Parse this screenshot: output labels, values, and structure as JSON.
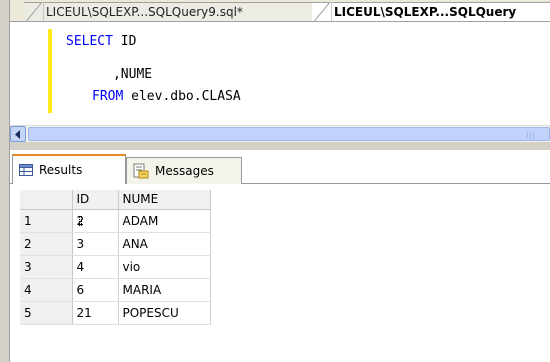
{
  "tabs": {
    "inactive_label": "LICEUL\\SQLEXP...SQLQuery9.sql*",
    "active_label": "LICEUL\\SQLEXP...SQLQuery"
  },
  "editor": {
    "line1_kw": "SELECT",
    "line1_rest": " ID",
    "line2": "      ,NUME",
    "line3_kw": "FROM",
    "line3_rest": " elev.dbo.CLASA"
  },
  "scrollbar": {
    "grip": "|||"
  },
  "results_tabs": {
    "results_label": "Results",
    "messages_label": "Messages"
  },
  "grid": {
    "columns": [
      "ID",
      "NUME"
    ],
    "rows": [
      {
        "num": "1",
        "id": "2",
        "nume": "ADAM"
      },
      {
        "num": "2",
        "id": "3",
        "nume": "ANA"
      },
      {
        "num": "3",
        "id": "4",
        "nume": "vio"
      },
      {
        "num": "4",
        "id": "6",
        "nume": "MARIA"
      },
      {
        "num": "5",
        "id": "21",
        "nume": "POPESCU"
      }
    ]
  },
  "colors": {
    "keyword": "#0000ff",
    "change_marker": "#ffeb1c",
    "active_tab_accent": "#e68b2c"
  }
}
